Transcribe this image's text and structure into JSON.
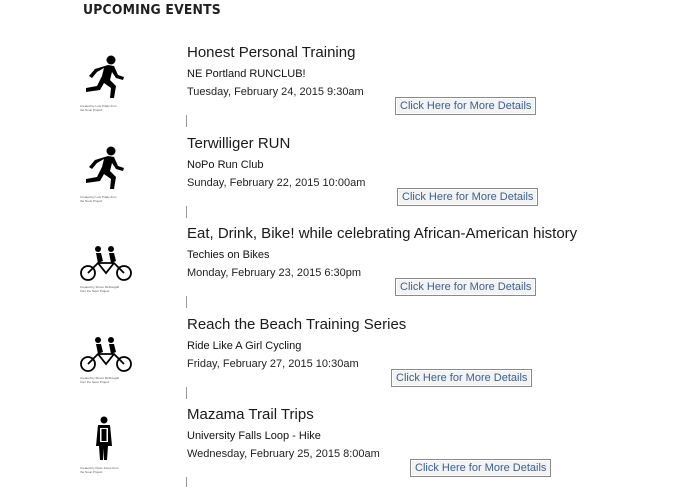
{
  "section": {
    "heading": "UPCOMING EVENTS"
  },
  "button_label": "Click Here for More Details",
  "events": [
    {
      "title": "Honest Personal Training",
      "organizer": "NE Portland RUNCLUB!",
      "datetime": "Tuesday, February 24, 2015 9:30am",
      "icon": "runner-icon",
      "credit": "Created by Luis Prado from the Noun Project"
    },
    {
      "title": "Terwilliger RUN",
      "organizer": "NoPo Run Club",
      "datetime": "Sunday, February 22, 2015 10:00am",
      "icon": "runner-icon",
      "credit": "Created by Luis Prado from the Noun Project"
    },
    {
      "title": "Eat, Drink, Bike! while celebrating African-American history",
      "organizer": "Techies on Bikes",
      "datetime": "Monday, February 23, 2015 6:30pm",
      "icon": "tandem-bike-icon",
      "credit": "Created by Simon McDougall from the Noun Project"
    },
    {
      "title": "Reach the Beach Training Series",
      "organizer": "Ride Like A Girl Cycling",
      "datetime": "Friday, February 27, 2015 10:30am",
      "icon": "tandem-bike-icon",
      "credit": "Created by Simon McDougall from the Noun Project"
    },
    {
      "title": "Mazama Trail Trips",
      "organizer": "University Falls Loop - Hike",
      "datetime": "Wednesday, February 25, 2015 8:00am",
      "icon": "hiker-icon",
      "credit": "Created by Peter Jones from the Noun Project"
    }
  ]
}
